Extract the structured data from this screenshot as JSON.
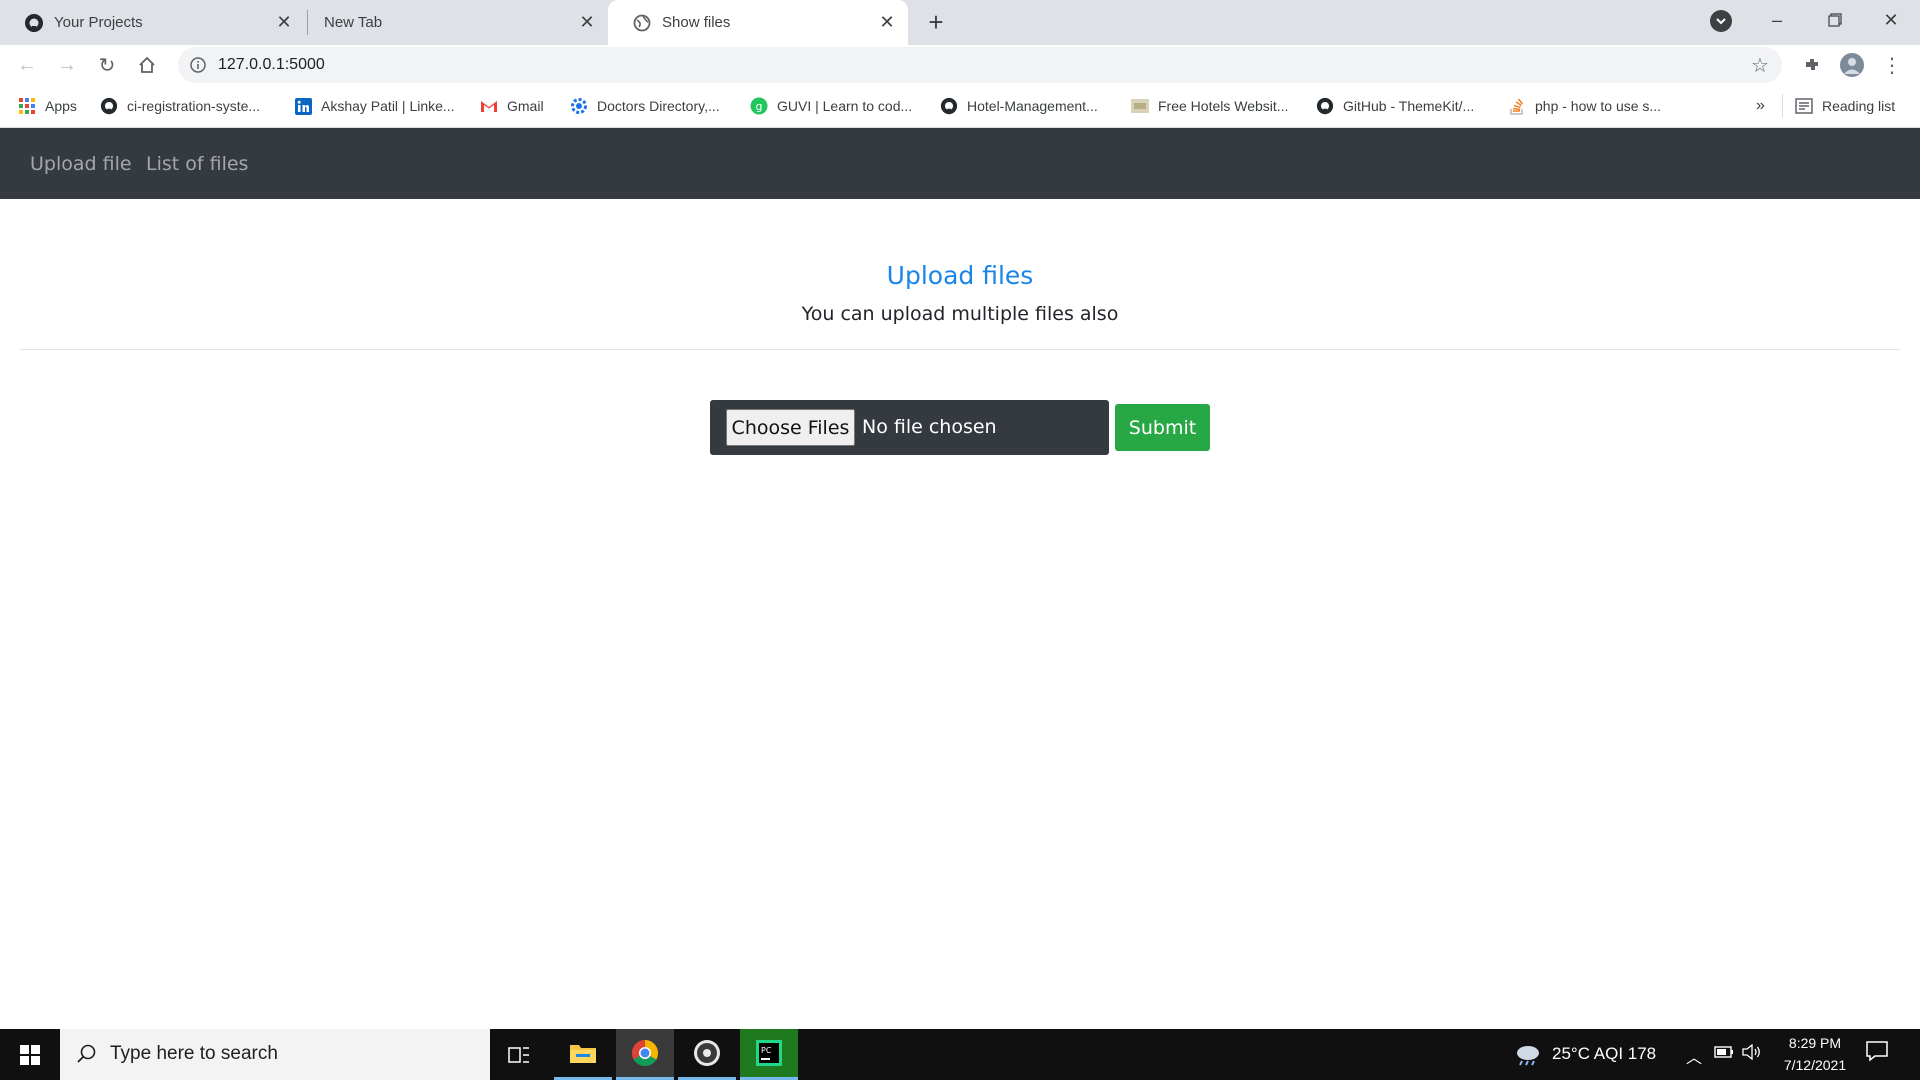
{
  "browser": {
    "tabs": [
      {
        "title": "Your Projects",
        "icon": "github-icon",
        "active": false
      },
      {
        "title": "New Tab",
        "icon": "none",
        "active": false
      },
      {
        "title": "Show files",
        "icon": "globe-icon",
        "active": true
      }
    ],
    "url": "127.0.0.1:5000",
    "bookmarks": [
      {
        "label": "Apps",
        "icon": "apps-grid-icon"
      },
      {
        "label": "ci-registration-syste...",
        "icon": "github-icon"
      },
      {
        "label": "Akshay Patil | Linke...",
        "icon": "linkedin-icon"
      },
      {
        "label": "Gmail",
        "icon": "gmail-icon"
      },
      {
        "label": "Doctors Directory,...",
        "icon": "gear-icon"
      },
      {
        "label": "GUVI | Learn to cod...",
        "icon": "guvi-icon"
      },
      {
        "label": "Hotel-Management...",
        "icon": "github-icon"
      },
      {
        "label": "Free Hotels Websit...",
        "icon": "image-icon"
      },
      {
        "label": "GitHub - ThemeKit/...",
        "icon": "github-icon"
      },
      {
        "label": "php - how to use s...",
        "icon": "stackoverflow-icon"
      }
    ],
    "overflow": "»",
    "reading_list": "Reading list"
  },
  "navbar": {
    "links": [
      "Upload file",
      "List of files"
    ]
  },
  "main": {
    "title": "Upload files",
    "subtitle": "You can upload multiple files also",
    "choose_label": "Choose Files",
    "no_file_text": "No file chosen",
    "submit_label": "Submit"
  },
  "taskbar": {
    "search_placeholder": "Type here to search",
    "weather": "25°C AQI 178",
    "time": "8:29 PM",
    "date": "7/12/2021"
  },
  "colors": {
    "navbar_bg": "#343a40",
    "title_blue": "#1a85e8",
    "submit_green": "#28a745"
  }
}
